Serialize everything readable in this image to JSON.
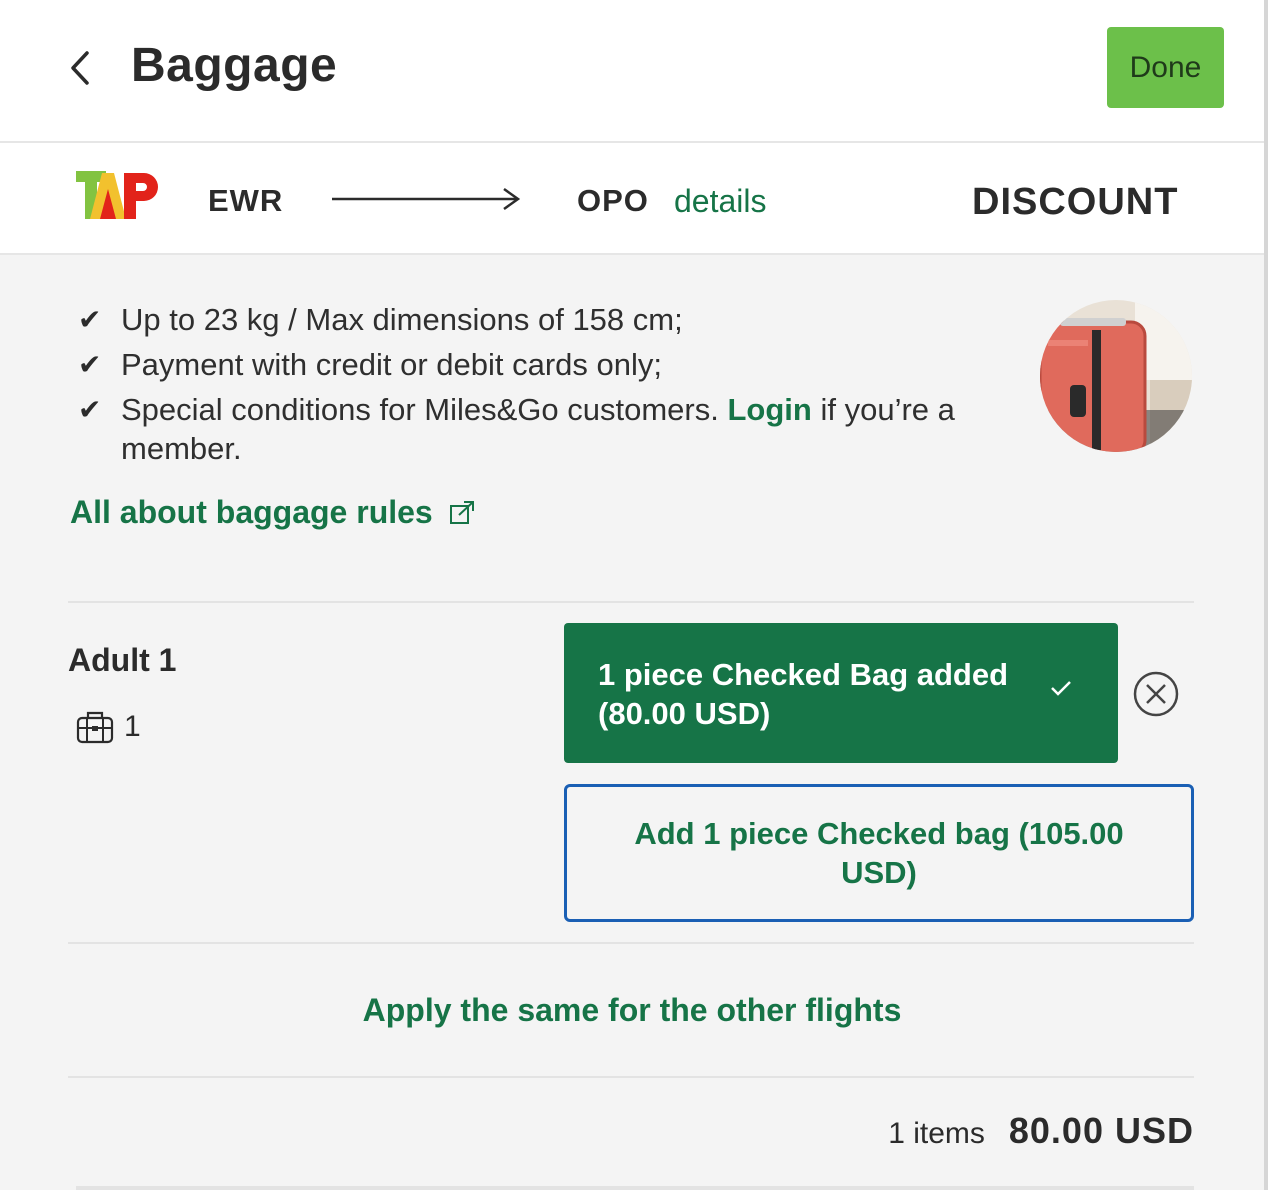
{
  "header": {
    "title": "Baggage",
    "done_label": "Done"
  },
  "flight": {
    "airline_logo": "TAP",
    "origin": "EWR",
    "destination": "OPO",
    "details_label": "details",
    "fare_label": "DISCOUNT"
  },
  "info": {
    "item1": "Up to 23 kg / Max dimensions of 158 cm;",
    "item2": "Payment with credit or debit cards only;",
    "item3_before": "Special conditions for Miles&Go customers.",
    "item3_link": "Login",
    "item3_after": "if you’re a member.",
    "rules_link": "All about baggage rules"
  },
  "passenger": {
    "name": "Adult 1",
    "bag_count": "1",
    "added_bag_label": "1 piece Checked Bag added (80.00 USD)",
    "add_bag_label": "Add 1 piece Checked bag (105.00 USD)"
  },
  "apply_label": "Apply the same for the other flights",
  "summary": {
    "items": "1 items",
    "total": "80.00 USD"
  },
  "colors": {
    "brand_green": "#167447",
    "done_green": "#6cc04a",
    "focus_blue": "#1a5fb4"
  }
}
